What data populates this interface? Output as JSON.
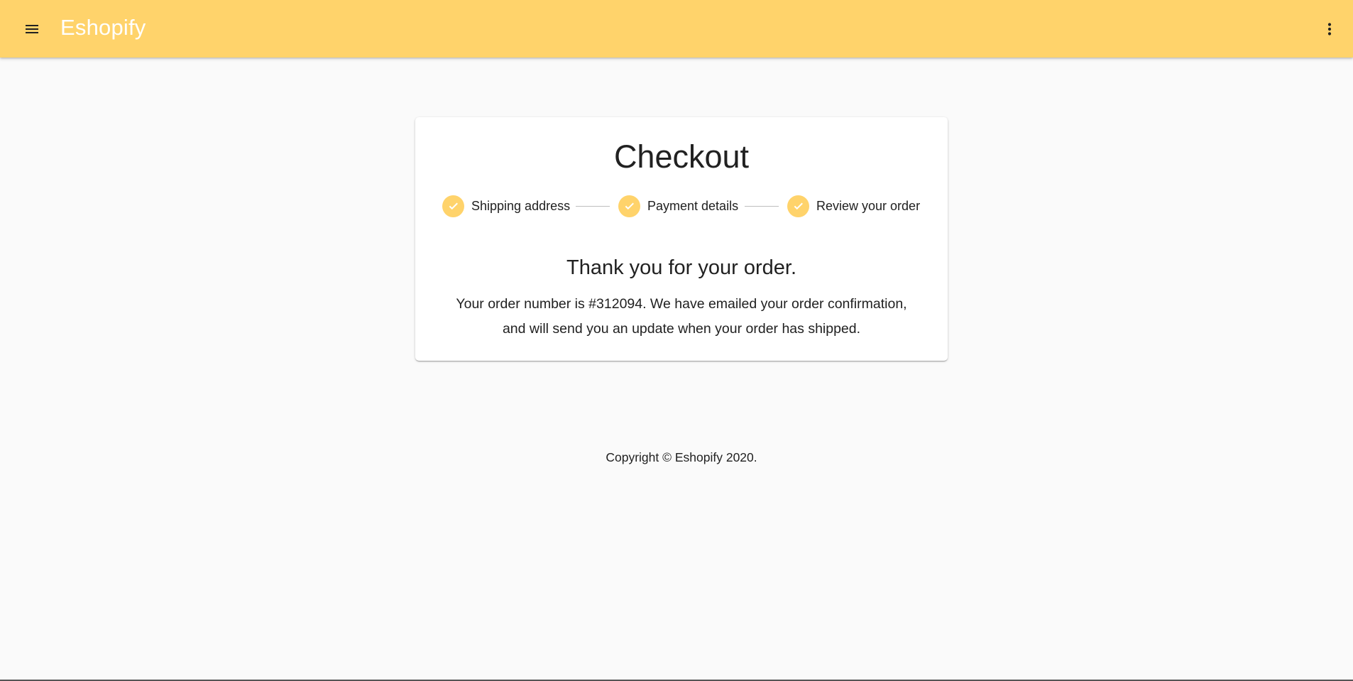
{
  "appbar": {
    "brand": "Eshopify",
    "menu_icon": "hamburger-menu-icon",
    "more_icon": "more-vertical-icon",
    "background": "#ffd36b"
  },
  "checkout": {
    "title": "Checkout",
    "steps": [
      {
        "label": "Shipping address",
        "icon": "check-circle-icon",
        "state": "completed"
      },
      {
        "label": "Payment details",
        "icon": "check-circle-icon",
        "state": "completed"
      },
      {
        "label": "Review your order",
        "icon": "check-circle-icon",
        "state": "completed"
      }
    ],
    "thanks_heading": "Thank you for your order.",
    "message_line1": "Your order number is #312094. We have emailed your order confirmation,",
    "message_line2": "and will send you an update when your order has shipped."
  },
  "footer": {
    "copyright": "Copyright © Eshopify 2020."
  },
  "colors": {
    "accent": "#ffd36b",
    "page_background": "#fafafa"
  }
}
